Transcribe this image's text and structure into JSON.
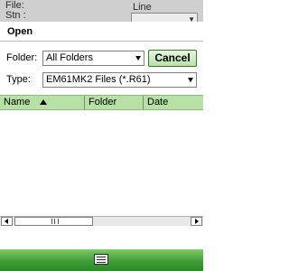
{
  "background": {
    "file_label": "File:",
    "station_label": "Stn :",
    "line_label": "Line"
  },
  "dialog": {
    "title": "Open",
    "folder_label": "Folder:",
    "folder_value": "All Folders",
    "type_label": "Type:",
    "type_value": "EM61MK2 Files (*.R61)",
    "cancel_label": "Cancel"
  },
  "list": {
    "columns": [
      "Name",
      "Folder",
      "Date"
    ],
    "sort_direction": "ascending",
    "rows": []
  },
  "scrollbar": {
    "thumb_grip": "III"
  },
  "softkeys": {
    "center_icon": "keyboard-icon"
  },
  "colors": {
    "accent_green": "#b6e0a5",
    "softbar_green": "#3f9e36"
  }
}
